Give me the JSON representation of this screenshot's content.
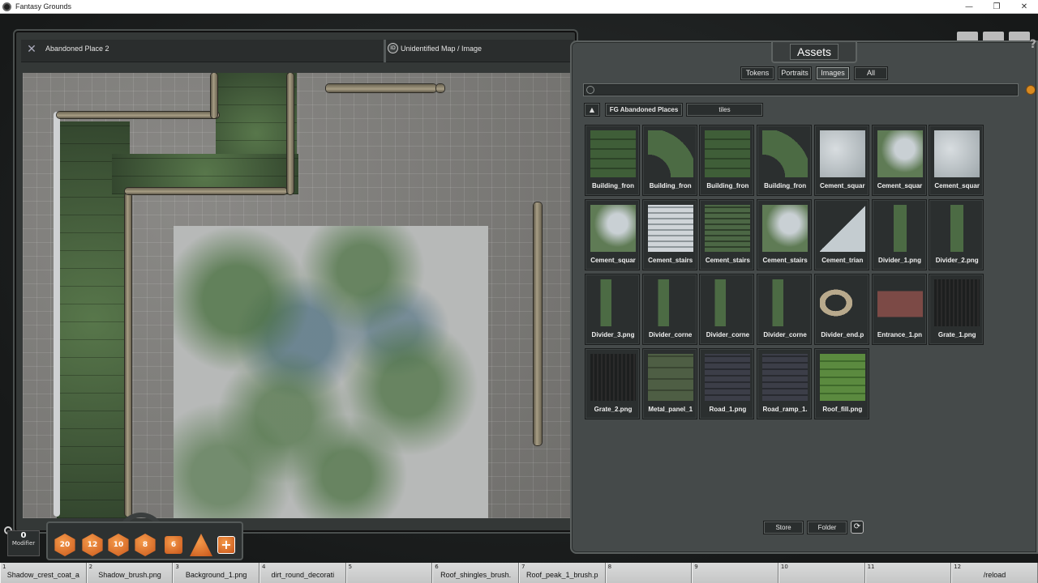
{
  "window": {
    "title": "Fantasy Grounds",
    "controls": [
      "—",
      "❐",
      "✕"
    ]
  },
  "image_window": {
    "name": "Abandoned Place 2",
    "id_badge": "ID",
    "id_label": "Unidentified Map / Image"
  },
  "assets": {
    "title": "Assets",
    "filters": [
      "Tokens",
      "Portraits",
      "Images",
      "All"
    ],
    "active_filter": "Images",
    "search_value": "",
    "path_up": "▲",
    "path": [
      "FG Abandoned Places",
      "tiles"
    ],
    "tiles": [
      {
        "label": "Building_fron",
        "style": "t-green"
      },
      {
        "label": "Building_fron",
        "style": "t-curve"
      },
      {
        "label": "Building_fron",
        "style": "t-green"
      },
      {
        "label": "Building_fron",
        "style": "t-curve"
      },
      {
        "label": "Cement_squar",
        "style": "t-cement"
      },
      {
        "label": "Cement_squar",
        "style": "t-cementg"
      },
      {
        "label": "Cement_squar",
        "style": "t-cement"
      },
      {
        "label": "Cement_squar",
        "style": "t-cementg"
      },
      {
        "label": "Cement_stairs",
        "style": "t-stairs"
      },
      {
        "label": "Cement_stairs",
        "style": "t-stairsg"
      },
      {
        "label": "Cement_stairs",
        "style": "t-cementg"
      },
      {
        "label": "Cement_trian",
        "style": "t-trian"
      },
      {
        "label": "Divider_1.png",
        "style": "t-div"
      },
      {
        "label": "Divider_2.png",
        "style": "t-div"
      },
      {
        "label": "Divider_3.png",
        "style": "t-corner"
      },
      {
        "label": "Divider_corne",
        "style": "t-corner"
      },
      {
        "label": "Divider_corne",
        "style": "t-corner"
      },
      {
        "label": "Divider_corne",
        "style": "t-corner"
      },
      {
        "label": "Divider_end.p",
        "style": "t-dend"
      },
      {
        "label": "Entrance_1.pn",
        "style": "t-entr"
      },
      {
        "label": "Grate_1.png",
        "style": "t-grate"
      },
      {
        "label": "Grate_2.png",
        "style": "t-grate"
      },
      {
        "label": "Metal_panel_1",
        "style": "t-metal"
      },
      {
        "label": "Road_1.png",
        "style": "t-road"
      },
      {
        "label": "Road_ramp_1.",
        "style": "t-road"
      },
      {
        "label": "Roof_fill.png",
        "style": "t-roof"
      }
    ],
    "store_label": "Store",
    "folder_label": "Folder",
    "help": "?"
  },
  "dice": {
    "modifier_value": "0",
    "modifier_label": "Modifier",
    "dice": [
      {
        "label": "20",
        "shape": "hex"
      },
      {
        "label": "12",
        "shape": "hex"
      },
      {
        "label": "10",
        "shape": "hex"
      },
      {
        "label": "8",
        "shape": "hex"
      },
      {
        "label": "6",
        "shape": "sq"
      },
      {
        "label": "",
        "shape": "tri"
      },
      {
        "label": "+",
        "shape": "plus"
      }
    ]
  },
  "hotkeys": [
    {
      "num": "1",
      "label": "Shadow_crest_coat_a"
    },
    {
      "num": "2",
      "label": "Shadow_brush.png"
    },
    {
      "num": "3",
      "label": "Background_1.png"
    },
    {
      "num": "4",
      "label": "dirt_round_decorati"
    },
    {
      "num": "5",
      "label": ""
    },
    {
      "num": "6",
      "label": "Roof_shingles_brush."
    },
    {
      "num": "7",
      "label": "Roof_peak_1_brush.p"
    },
    {
      "num": "8",
      "label": ""
    },
    {
      "num": "9",
      "label": ""
    },
    {
      "num": "10",
      "label": ""
    },
    {
      "num": "11",
      "label": ""
    },
    {
      "num": "12",
      "label": "/reload"
    }
  ]
}
